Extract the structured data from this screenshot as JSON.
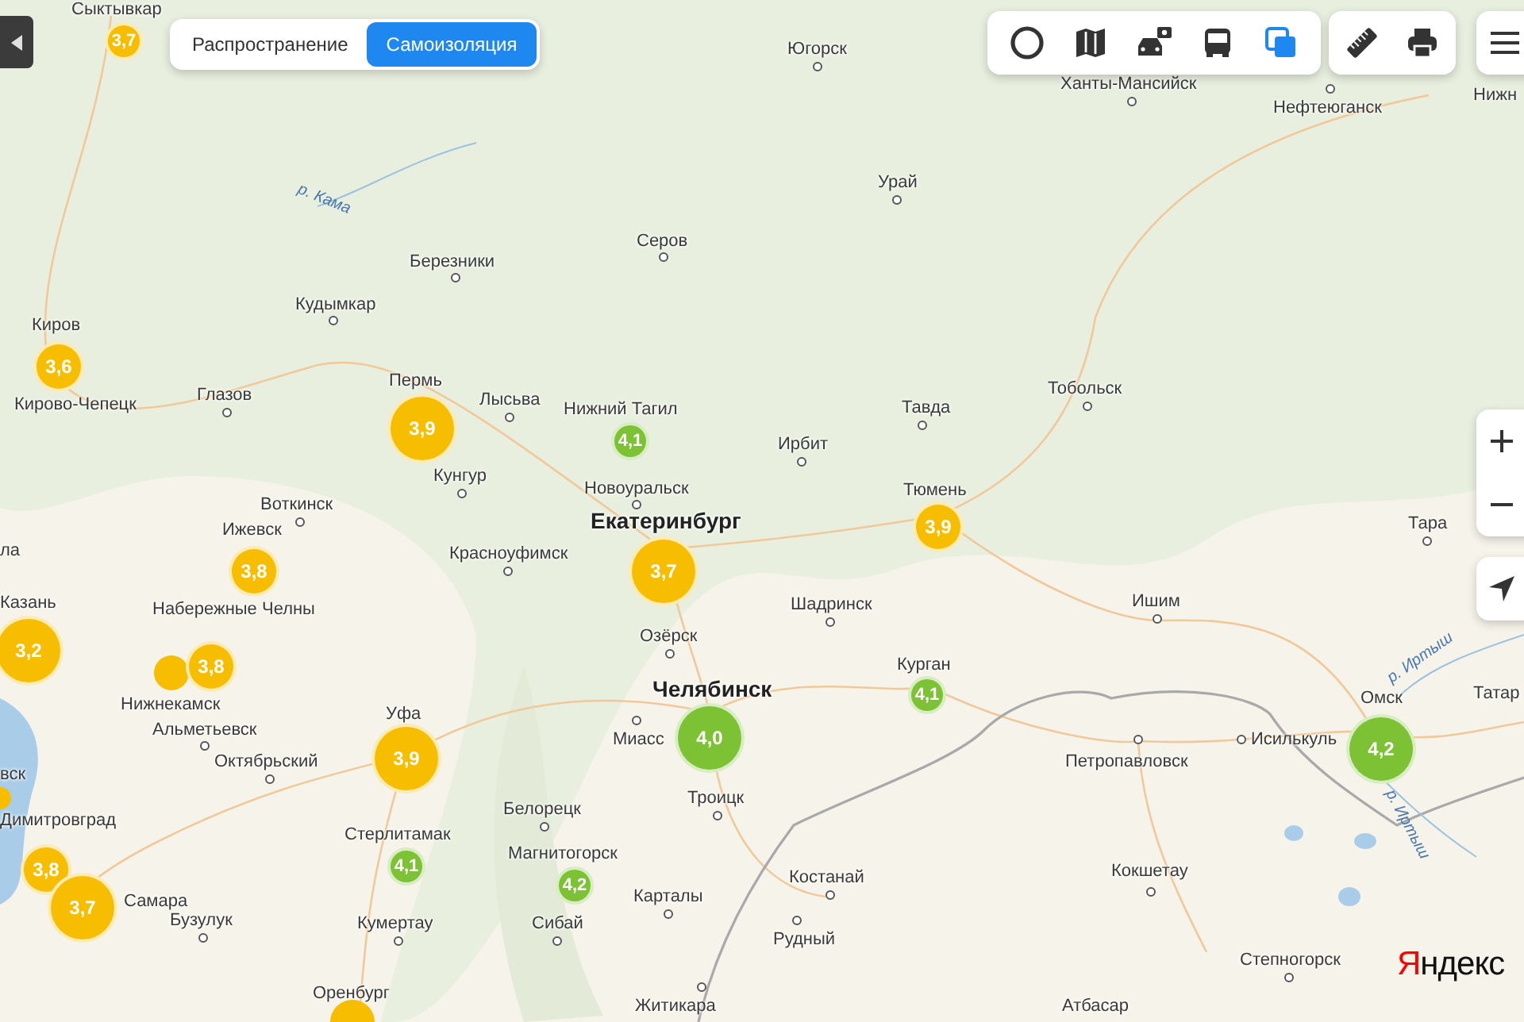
{
  "mode_switch": [
    {
      "label": "Распространение",
      "selected": false
    },
    {
      "label": "Самоизоляция",
      "selected": true
    }
  ],
  "map_tools": [
    {
      "kind": "ring",
      "selected": false
    },
    {
      "kind": "atlas",
      "selected": false
    },
    {
      "kind": "camera",
      "selected": false
    },
    {
      "kind": "bus",
      "selected": false
    },
    {
      "kind": "layers",
      "selected": true
    }
  ],
  "cities": [
    {
      "name": "Сыктывкар",
      "kind": "town"
    },
    {
      "name": "Югорск",
      "kind": "town"
    },
    {
      "name": "Ханты-Мансийск",
      "kind": "town"
    },
    {
      "name": "Нефтеюганск",
      "kind": "town"
    },
    {
      "name": "Нижн",
      "kind": "town"
    },
    {
      "name": "Урай",
      "kind": "town"
    },
    {
      "name": "Серов",
      "kind": "town"
    },
    {
      "name": "Березники",
      "kind": "town"
    },
    {
      "name": "Кудымкар",
      "kind": "town"
    },
    {
      "name": "Тобольск",
      "kind": "town"
    },
    {
      "name": "Киров",
      "kind": "town"
    },
    {
      "name": "Кирово-Чепецк",
      "kind": "town"
    },
    {
      "name": "Глазов",
      "kind": "town"
    },
    {
      "name": "Лысьва",
      "kind": "town"
    },
    {
      "name": "Пермь",
      "kind": "town"
    },
    {
      "name": "Нижний Тагил",
      "kind": "town"
    },
    {
      "name": "Тавда",
      "kind": "town"
    },
    {
      "name": "Ирбит",
      "kind": "town"
    },
    {
      "name": "Кунгур",
      "kind": "town"
    },
    {
      "name": "Новоуральск",
      "kind": "town"
    },
    {
      "name": "Тюмень",
      "kind": "town"
    },
    {
      "name": "Воткинск",
      "kind": "town"
    },
    {
      "name": "Ижевск",
      "kind": "town"
    },
    {
      "name": "Екатеринбург",
      "kind": "major"
    },
    {
      "name": "Тара",
      "kind": "town"
    },
    {
      "name": "ла",
      "kind": "town"
    },
    {
      "name": "Красноуфимск",
      "kind": "town"
    },
    {
      "name": "Шадринск",
      "kind": "town"
    },
    {
      "name": "Ишим",
      "kind": "town"
    },
    {
      "name": "Набережные Челны",
      "kind": "town"
    },
    {
      "name": "Казань",
      "kind": "town"
    },
    {
      "name": "Озёрск",
      "kind": "town"
    },
    {
      "name": "Нижнекамск",
      "kind": "town"
    },
    {
      "name": "Курган",
      "kind": "town"
    },
    {
      "name": "Челябинск",
      "kind": "major"
    },
    {
      "name": "Омск",
      "kind": "town"
    },
    {
      "name": "Татар",
      "kind": "town"
    },
    {
      "name": "Альметьевск",
      "kind": "town"
    },
    {
      "name": "Уфа",
      "kind": "town"
    },
    {
      "name": "Миасс",
      "kind": "town"
    },
    {
      "name": "Исилькуль",
      "kind": "town"
    },
    {
      "name": "вск",
      "kind": "town"
    },
    {
      "name": "Октябрьский",
      "kind": "town"
    },
    {
      "name": "Петропавловск",
      "kind": "town"
    },
    {
      "name": "Димитровград",
      "kind": "town"
    },
    {
      "name": "Белорецк",
      "kind": "town"
    },
    {
      "name": "Троицк",
      "kind": "town"
    },
    {
      "name": "Стерлитамак",
      "kind": "town"
    },
    {
      "name": "Магнитогорск",
      "kind": "town"
    },
    {
      "name": "Костанай",
      "kind": "town"
    },
    {
      "name": "Кокшетау",
      "kind": "town"
    },
    {
      "name": "Самара",
      "kind": "town"
    },
    {
      "name": "Карталы",
      "kind": "town"
    },
    {
      "name": "Бузулук",
      "kind": "town"
    },
    {
      "name": "Кумертау",
      "kind": "town"
    },
    {
      "name": "Сибай",
      "kind": "town"
    },
    {
      "name": "Рудный",
      "kind": "town"
    },
    {
      "name": "Степногорск",
      "kind": "town"
    },
    {
      "name": "Оренбург",
      "kind": "town"
    },
    {
      "name": "Житикара",
      "kind": "town"
    },
    {
      "name": "Атбасар",
      "kind": "town"
    }
  ],
  "rivers": [
    {
      "name": "р. Кама"
    },
    {
      "name": "р. Иртыш"
    },
    {
      "name": "р. Иртыш"
    }
  ],
  "ratings": [
    {
      "value": "3,7",
      "color": "#f7bd00",
      "kind": "small"
    },
    {
      "value": "3,6",
      "color": "#f7bd00",
      "kind": "medium"
    },
    {
      "value": "3,9",
      "color": "#f7bd00",
      "kind": "large"
    },
    {
      "value": "4,1",
      "color": "#7cc234",
      "kind": "small"
    },
    {
      "value": "3,9",
      "color": "#f7bd00",
      "kind": "medium"
    },
    {
      "value": "3,7",
      "color": "#f7bd00",
      "kind": "large"
    },
    {
      "value": "3,8",
      "color": "#f7bd00",
      "kind": "medium"
    },
    {
      "value": "3,2",
      "color": "#f7bd00",
      "kind": "large"
    },
    {
      "value": "3,8",
      "color": "#f7bd00",
      "kind": "medium"
    },
    {
      "value": "4,1",
      "color": "#7cc234",
      "kind": "small"
    },
    {
      "value": "4,0",
      "color": "#7cc234",
      "kind": "large"
    },
    {
      "value": "4,2",
      "color": "#7cc234",
      "kind": "large"
    },
    {
      "value": "3,9",
      "color": "#f7bd00",
      "kind": "large"
    },
    {
      "value": "4,1",
      "color": "#7cc234",
      "kind": "small"
    },
    {
      "value": "4,2",
      "color": "#7cc234",
      "kind": "small"
    },
    {
      "value": "3,8",
      "color": "#f7bd00",
      "kind": "medium"
    },
    {
      "value": "3,7",
      "color": "#f7bd00",
      "kind": "large"
    }
  ],
  "logo": "Яндекс"
}
